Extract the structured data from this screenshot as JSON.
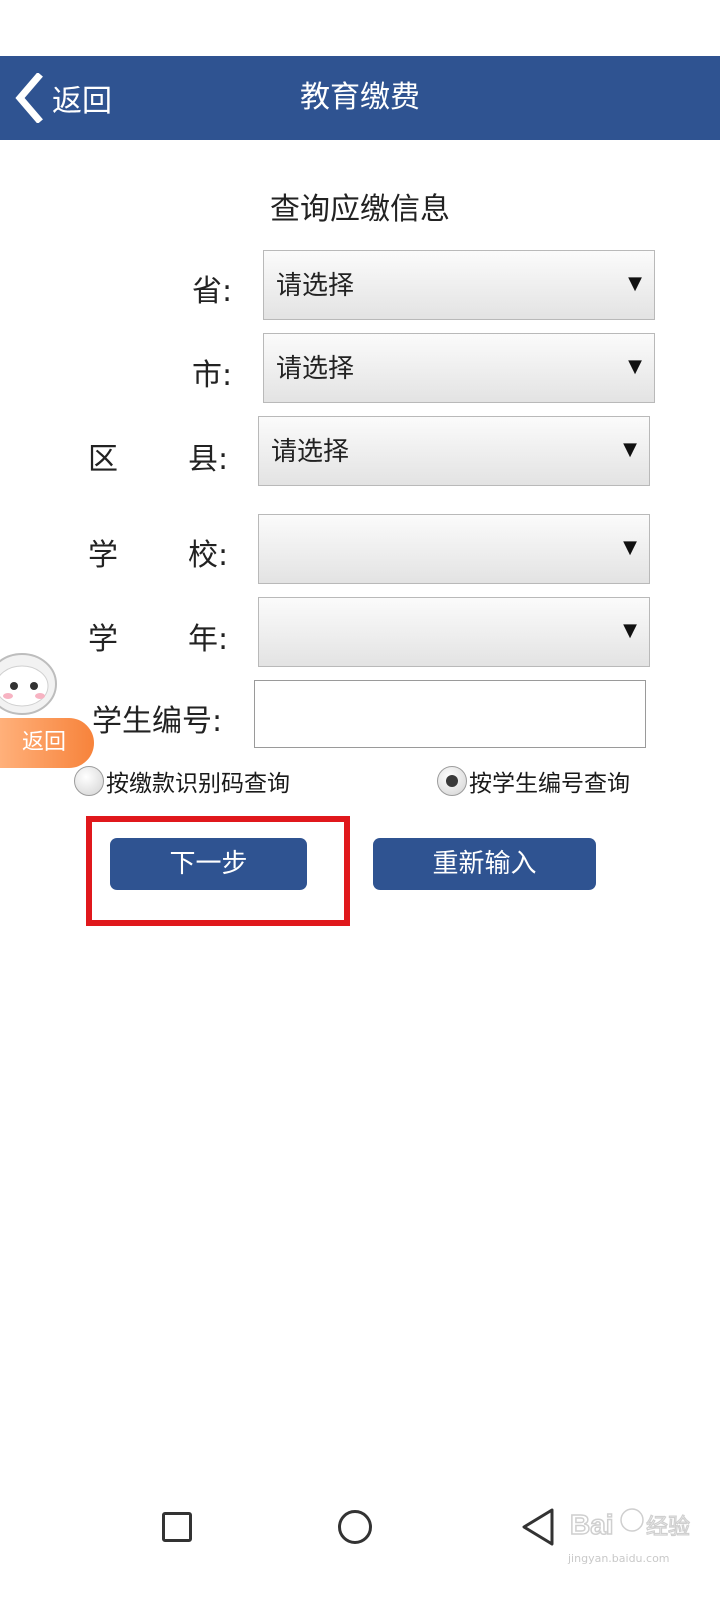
{
  "header": {
    "back_label": "返回",
    "title": "教育缴费",
    "color": "#2f5391"
  },
  "form": {
    "title": "查询应缴信息",
    "province": {
      "label": "省:",
      "value": "请选择"
    },
    "city": {
      "label": "市:",
      "value": "请选择"
    },
    "district": {
      "label_left": "区",
      "label_right": "县:",
      "value": "请选择"
    },
    "school": {
      "label_left": "学",
      "label_right": "校:",
      "value": ""
    },
    "year": {
      "label_left": "学",
      "label_right": "年:",
      "value": ""
    },
    "student_id": {
      "label": "学生编号:",
      "value": "",
      "placeholder": ""
    },
    "radio_options": [
      {
        "label": "按缴款识别码查询",
        "selected": false
      },
      {
        "label": "按学生编号查询",
        "selected": true
      }
    ],
    "next_button": "下一步",
    "reset_button": "重新输入"
  },
  "floating_widget": {
    "return_label": "返回",
    "color": "#f7833b"
  },
  "highlight_color": "#e0181c",
  "nav_bar": {
    "icons": [
      "recent-apps-icon",
      "home-icon",
      "back-icon"
    ]
  },
  "watermark": {
    "text": "jingyan.baidu.com"
  }
}
